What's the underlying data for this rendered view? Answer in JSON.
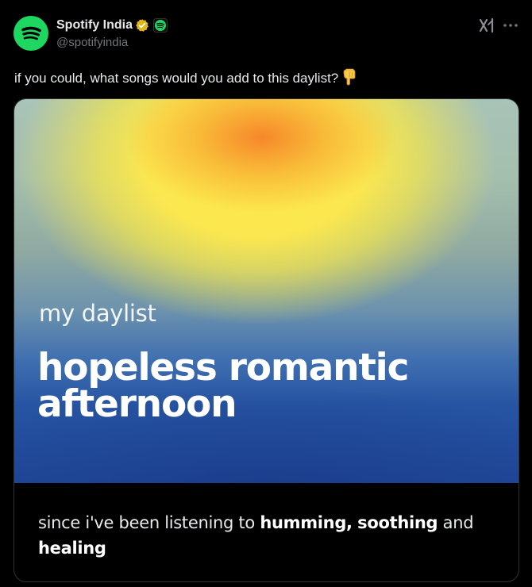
{
  "account": {
    "display_name": "Spotify India",
    "handle": "@spotifyindia"
  },
  "icons": {
    "avatar": "spotify-logo-icon",
    "verified": "verified-badge-icon",
    "affiliate": "spotify-affiliate-badge-icon",
    "grok": "grok-icon",
    "more": "more-options-icon",
    "emoji": "backhand-index-pointing-down-emoji"
  },
  "colors": {
    "spotify_green": "#1ed760",
    "verified_gold": "#e2b719",
    "background": "#000000",
    "text_primary": "#e7e9ea",
    "text_secondary": "#71767b"
  },
  "tweet": {
    "text": "if you could, what songs would you add to this daylist?"
  },
  "card": {
    "subtitle": "my daylist",
    "title": "hopeless romantic afternoon",
    "caption": {
      "prefix": "since i've been listening to",
      "highlight_1": "humming,",
      "highlight_2": "soothing",
      "middle": "and",
      "highlight_3": "healing"
    }
  }
}
